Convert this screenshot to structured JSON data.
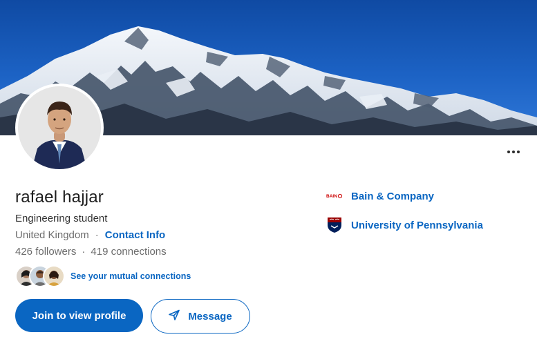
{
  "profile": {
    "name": "rafael hajjar",
    "headline": "Engineering student",
    "location": "United Kingdom",
    "separator": "·",
    "contact_info": "Contact Info",
    "followers": "426 followers",
    "connections": "419 connections",
    "mutual_connections": "See your mutual connections"
  },
  "actions": {
    "join": "Join to view profile",
    "message": "Message"
  },
  "experience": [
    {
      "name": "Bain & Company",
      "logo": "bain-logo",
      "logo_text": "BAIN"
    },
    {
      "name": "University of Pennsylvania",
      "logo": "penn-shield-logo"
    }
  ],
  "colors": {
    "accent": "#0a66c2",
    "bain_red": "#cc0000",
    "penn_blue": "#011f5b",
    "penn_red": "#990000"
  }
}
